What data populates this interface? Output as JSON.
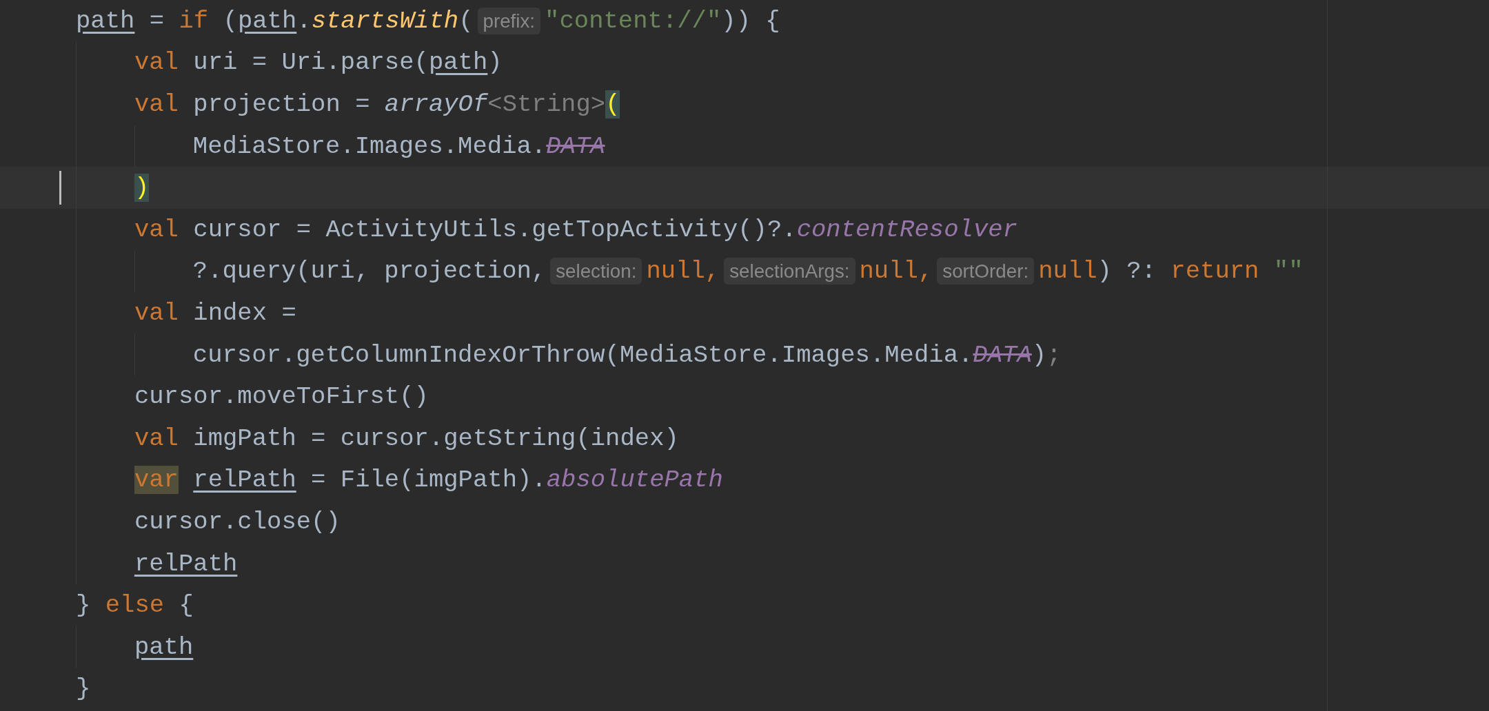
{
  "editor": {
    "lines": [
      {
        "current": false,
        "tokens": [
          {
            "kind": "var",
            "text": "path"
          },
          {
            "kind": "plain",
            "text": " = "
          },
          {
            "kind": "kw",
            "text": "if"
          },
          {
            "kind": "plain",
            "text": " ("
          },
          {
            "kind": "var",
            "text": "path"
          },
          {
            "kind": "plain",
            "text": "."
          },
          {
            "kind": "fn-ext",
            "text": "startsWith"
          },
          {
            "kind": "plain",
            "text": "("
          },
          {
            "kind": "hint",
            "text": "prefix:"
          },
          {
            "kind": "str",
            "text": "\"content://\""
          },
          {
            "kind": "plain",
            "text": ")) {"
          }
        ],
        "children": [
          {
            "current": false,
            "tokens": [
              {
                "kind": "kw",
                "text": "val"
              },
              {
                "kind": "plain",
                "text": " uri = Uri.parse("
              },
              {
                "kind": "var",
                "text": "path"
              },
              {
                "kind": "plain",
                "text": ")"
              }
            ]
          },
          {
            "current": false,
            "tokens": [
              {
                "kind": "kw",
                "text": "val"
              },
              {
                "kind": "plain",
                "text": " projection = "
              },
              {
                "kind": "fn-top",
                "text": "arrayOf"
              },
              {
                "kind": "type-hint",
                "text": "<String>"
              },
              {
                "kind": "brace",
                "text": "("
              }
            ],
            "children": [
              {
                "current": false,
                "tokens": [
                  {
                    "kind": "plain",
                    "text": "MediaStore.Images.Media."
                  },
                  {
                    "kind": "deprecated",
                    "text": "DATA"
                  }
                ]
              }
            ]
          },
          {
            "current": true,
            "tokens": [
              {
                "kind": "brace",
                "text": ")"
              }
            ]
          },
          {
            "current": false,
            "tokens": [
              {
                "kind": "kw",
                "text": "val"
              },
              {
                "kind": "plain",
                "text": " cursor = ActivityUtils.getTopActivity()?."
              },
              {
                "kind": "prop",
                "text": "contentResolver"
              }
            ],
            "children": [
              {
                "current": false,
                "tokens": [
                  {
                    "kind": "plain",
                    "text": "?.query(uri, projection,"
                  },
                  {
                    "kind": "hint",
                    "text": "selection:"
                  },
                  {
                    "kind": "kw",
                    "text": "null,"
                  },
                  {
                    "kind": "hint",
                    "text": "selectionArgs:"
                  },
                  {
                    "kind": "kw",
                    "text": "null,"
                  },
                  {
                    "kind": "hint",
                    "text": "sortOrder:"
                  },
                  {
                    "kind": "kw",
                    "text": "null"
                  },
                  {
                    "kind": "plain",
                    "text": ") ?: "
                  },
                  {
                    "kind": "kw",
                    "text": "return"
                  },
                  {
                    "kind": "str",
                    "text": " \"\""
                  }
                ]
              }
            ]
          },
          {
            "current": false,
            "tokens": [
              {
                "kind": "kw",
                "text": "val"
              },
              {
                "kind": "plain",
                "text": " index ="
              }
            ],
            "children": [
              {
                "current": false,
                "tokens": [
                  {
                    "kind": "plain",
                    "text": "cursor.getColumnIndexOrThrow(MediaStore.Images.Media."
                  },
                  {
                    "kind": "deprecated",
                    "text": "DATA"
                  },
                  {
                    "kind": "plain",
                    "text": ")"
                  },
                  {
                    "kind": "semi",
                    "text": ";"
                  }
                ]
              }
            ]
          },
          {
            "current": false,
            "tokens": [
              {
                "kind": "plain",
                "text": "cursor.moveToFirst()"
              }
            ]
          },
          {
            "current": false,
            "tokens": [
              {
                "kind": "kw",
                "text": "val"
              },
              {
                "kind": "plain",
                "text": " imgPath = cursor.getString(index)"
              }
            ]
          },
          {
            "current": false,
            "tokens": [
              {
                "kind": "kw-hl",
                "text": "var "
              },
              {
                "kind": "var",
                "text": "relPath"
              },
              {
                "kind": "plain",
                "text": " = File(imgPath)."
              },
              {
                "kind": "prop",
                "text": "absolutePath"
              }
            ]
          },
          {
            "current": false,
            "tokens": [
              {
                "kind": "plain",
                "text": "cursor.close()"
              }
            ]
          },
          {
            "current": false,
            "tokens": [
              {
                "kind": "var",
                "text": "relPath"
              }
            ]
          }
        ]
      },
      {
        "current": false,
        "tokens": [
          {
            "kind": "plain",
            "text": "} "
          },
          {
            "kind": "kw",
            "text": "else"
          },
          {
            "kind": "plain",
            "text": " {"
          }
        ],
        "children": [
          {
            "current": false,
            "tokens": [
              {
                "kind": "var",
                "text": "path"
              }
            ]
          }
        ]
      },
      {
        "current": false,
        "tokens": [
          {
            "kind": "plain",
            "text": "}"
          }
        ]
      }
    ]
  }
}
